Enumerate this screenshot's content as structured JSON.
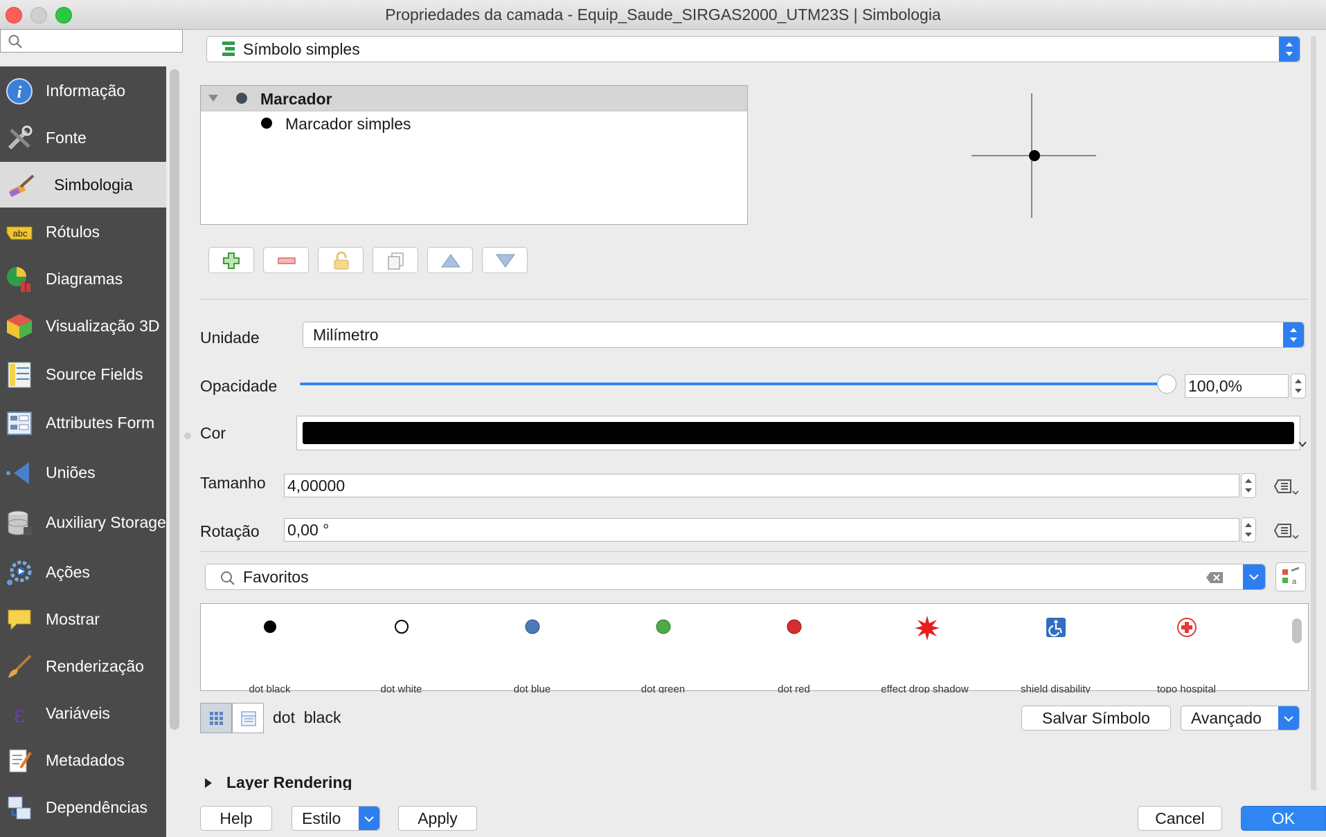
{
  "window": {
    "title": "Propriedades da camada - Equip_Saude_SIRGAS2000_UTM23S | Simbologia"
  },
  "sidebar": {
    "search_placeholder": "",
    "items": [
      {
        "label": "Informação",
        "icon": "info-icon"
      },
      {
        "label": "Fonte",
        "icon": "tools-icon"
      },
      {
        "label": "Simbologia",
        "icon": "paintbrush-icon",
        "selected": true
      },
      {
        "label": "Rótulos",
        "icon": "abc-label-icon"
      },
      {
        "label": "Diagramas",
        "icon": "diagram-icon"
      },
      {
        "label": "Visualização 3D",
        "icon": "cube-icon"
      },
      {
        "label": "Source Fields",
        "icon": "fields-icon"
      },
      {
        "label": "Attributes Form",
        "icon": "form-icon"
      },
      {
        "label": "Uniões",
        "icon": "join-icon"
      },
      {
        "label": "Auxiliary Storage",
        "icon": "database-icon"
      },
      {
        "label": "Ações",
        "icon": "gear-icon"
      },
      {
        "label": "Mostrar",
        "icon": "speech-bubble-icon"
      },
      {
        "label": "Renderização",
        "icon": "brush-icon"
      },
      {
        "label": "Variáveis",
        "icon": "epsilon-icon"
      },
      {
        "label": "Metadados",
        "icon": "document-edit-icon"
      },
      {
        "label": "Dependências",
        "icon": "dependencies-icon"
      }
    ]
  },
  "renderer": {
    "type": "Símbolo simples"
  },
  "layer_tree": {
    "root": "Marcador",
    "child": "Marcador simples"
  },
  "properties": {
    "unit_label": "Unidade",
    "unit_value": "Milímetro",
    "opacity_label": "Opacidade",
    "opacity_value": "100,0%",
    "opacity_fraction": 1.0,
    "color_label": "Cor",
    "color_value": "#000000",
    "size_label": "Tamanho",
    "size_value": "4,00000",
    "rotation_label": "Rotação",
    "rotation_value": "0,00 °"
  },
  "library": {
    "filter_value": "Favoritos",
    "symbols": [
      {
        "name": "dot  black",
        "color": "#000000"
      },
      {
        "name": "dot  white",
        "color": "#ffffff"
      },
      {
        "name": "dot  blue",
        "color": "#4a7ab8"
      },
      {
        "name": "dot  green",
        "color": "#4daa4a"
      },
      {
        "name": "dot  red",
        "color": "#d42e2e"
      },
      {
        "name": "effect drop shadow",
        "color": "#e51e1e"
      },
      {
        "name": "shield disability",
        "color": "#2f6fc2"
      },
      {
        "name": "topo hospital",
        "color": "#e23a3a"
      }
    ],
    "selected_name": "dot  black",
    "save_button": "Salvar Símbolo",
    "advanced_button": "Avançado"
  },
  "layer_rendering": {
    "label": "Layer Rendering"
  },
  "footer": {
    "help": "Help",
    "style": "Estilo",
    "apply": "Apply",
    "cancel": "Cancel",
    "ok": "OK"
  },
  "colors": {
    "accent": "#2f7ef0",
    "sidebar_bg": "#4a4a4a"
  }
}
